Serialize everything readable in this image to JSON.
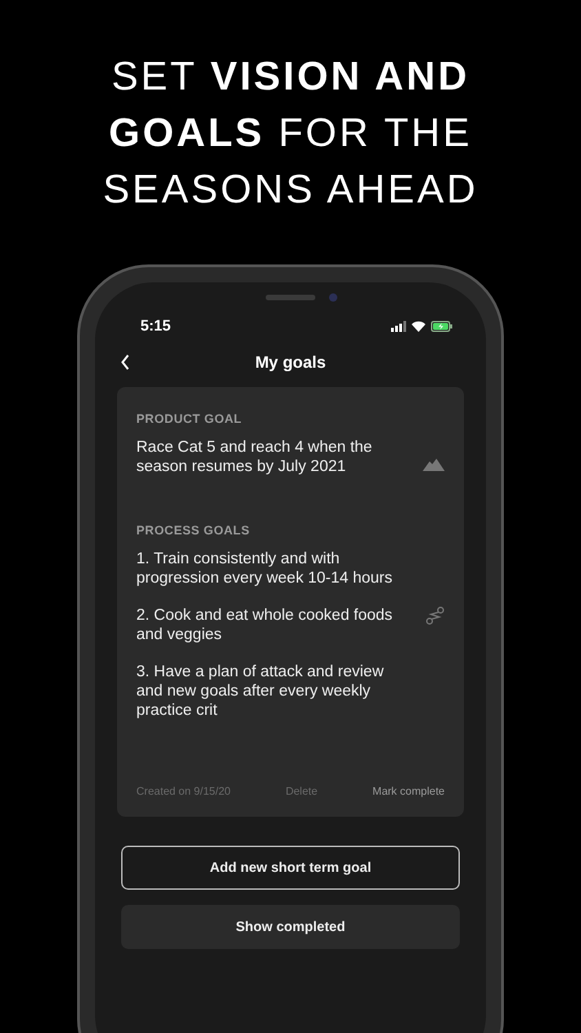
{
  "headline": "SET **VISION AND**\n**GOALS** FOR THE\nSEASONS AHEAD",
  "status_bar": {
    "time": "5:15"
  },
  "nav": {
    "title": "My goals"
  },
  "goal_card": {
    "product_label": "PRODUCT GOAL",
    "product_goal": "Race Cat 5 and reach 4 when the season resumes by July 2021",
    "process_label": "PROCESS GOALS",
    "process_goals": [
      "1. Train consistently and with progression every week 10-14 hours",
      "2. Cook and eat whole cooked foods and veggies",
      "3. Have a plan of attack and review and new goals after every weekly practice crit"
    ],
    "created": "Created on 9/15/20",
    "delete": "Delete",
    "mark_complete": "Mark complete"
  },
  "buttons": [
    {
      "label": "Add new short term goal",
      "kind": "outline"
    },
    {
      "label": "Show completed",
      "kind": "filled"
    }
  ]
}
